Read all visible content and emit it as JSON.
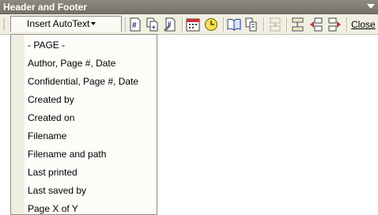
{
  "title": "Header and Footer",
  "toolbar": {
    "insert_autotext_label": "Insert AutoText",
    "close_label": "Close",
    "icons": [
      "insert-page-number-icon",
      "insert-number-of-pages-icon",
      "format-page-number-icon",
      "insert-date-icon",
      "insert-time-icon",
      "page-setup-icon",
      "show-hide-document-text-icon",
      "same-as-previous-icon",
      "switch-header-footer-icon",
      "show-previous-icon",
      "show-next-icon"
    ]
  },
  "menu": {
    "items": [
      "- PAGE -",
      "Author, Page #, Date",
      "Confidential, Page #, Date",
      "Created by",
      "Created on",
      "Filename",
      "Filename and path",
      "Last printed",
      "Last saved by",
      "Page X of Y"
    ]
  },
  "colors": {
    "titlebar": "#7f7c72",
    "toolbar": "#f1efe2",
    "menu_background": "#fcfcf9",
    "menu_stripe": "#f0eee3"
  }
}
